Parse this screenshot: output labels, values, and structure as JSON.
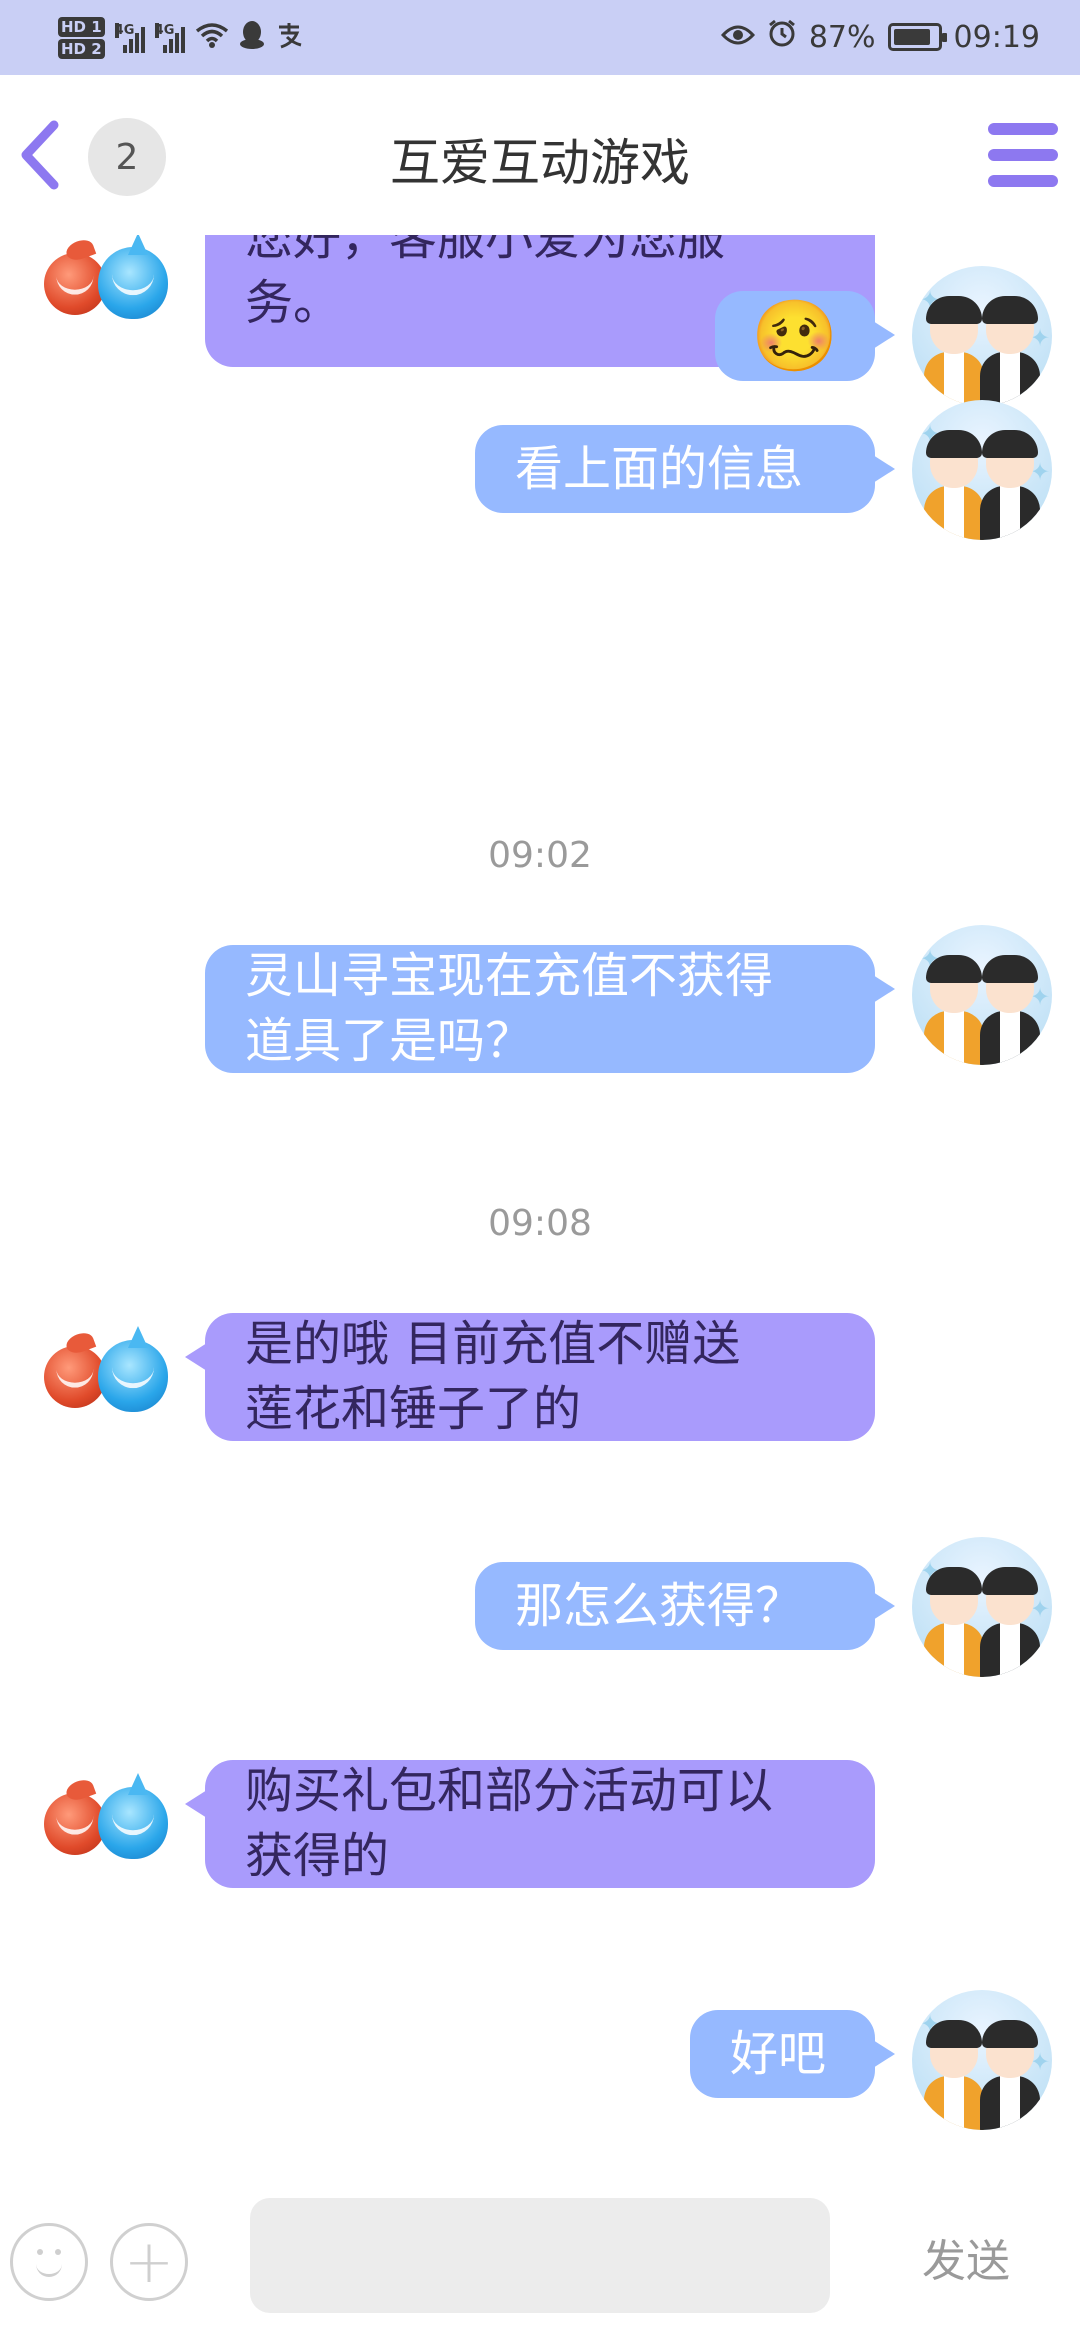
{
  "status_bar": {
    "hd1": "HD 1",
    "hd2": "HD 2",
    "net1": "4G",
    "net2": "4G",
    "battery_percent": "87%",
    "battery_level": 0.87,
    "time": "09:19",
    "left_icons": [
      "wifi-icon",
      "qq-icon",
      "alipay-icon"
    ],
    "right_icons": [
      "eye-icon",
      "alarm-icon",
      "battery-icon"
    ]
  },
  "header": {
    "title": "互爱互动游戏",
    "unread_count": "2"
  },
  "messages": [
    {
      "from": "agent",
      "text": "您好，客服小爱为您服\n务。"
    },
    {
      "from": "user",
      "type": "emoji",
      "text": "🥴"
    },
    {
      "from": "user",
      "text": "看上面的信息"
    },
    {
      "type": "time",
      "text": "09:02"
    },
    {
      "from": "user",
      "text": "灵山寻宝现在充值不获得\n道具了是吗？"
    },
    {
      "type": "time",
      "text": "09:08"
    },
    {
      "from": "agent",
      "text": "是的哦 目前充值不赠送\n莲花和锤子了的"
    },
    {
      "from": "user",
      "text": "那怎么获得？"
    },
    {
      "from": "agent",
      "text": "购买礼包和部分活动可以\n获得的"
    },
    {
      "from": "user",
      "text": "好吧"
    }
  ],
  "input_bar": {
    "placeholder": "",
    "send_label": "发送",
    "plus_symbol": "+"
  },
  "colors": {
    "agent_bubble": "#a99bfc",
    "user_bubble": "#96b9ff",
    "accent": "#8d78f0",
    "status_bar_bg": "#c9cff5"
  }
}
